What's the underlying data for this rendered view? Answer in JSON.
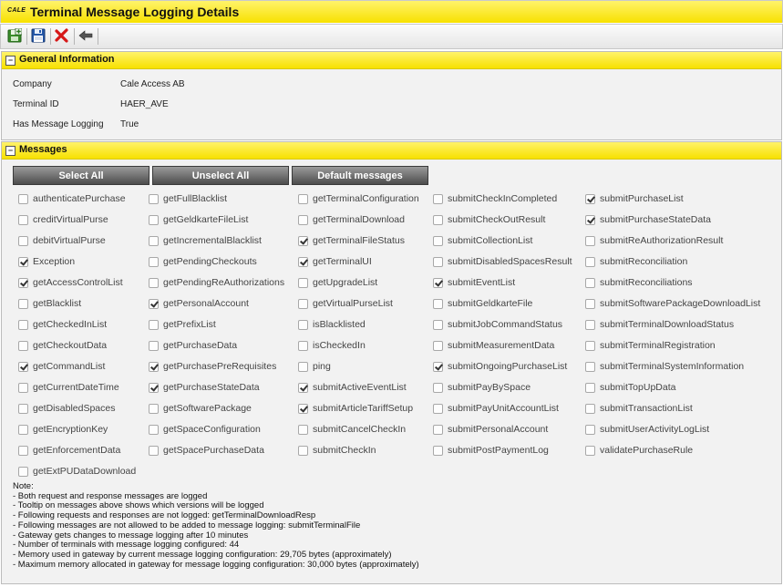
{
  "header": {
    "logo": "CALE",
    "title": "Terminal Message Logging Details"
  },
  "toolbar": {
    "icons": [
      "save-new-icon",
      "save-icon",
      "delete-icon",
      "back-icon"
    ]
  },
  "general": {
    "heading": "General Information",
    "toggle": "−",
    "rows": [
      {
        "label": "Company",
        "value": "Cale Access AB"
      },
      {
        "label": "Terminal ID",
        "value": "HAER_AVE"
      },
      {
        "label": "Has Message Logging",
        "value": "True"
      }
    ]
  },
  "messages": {
    "heading": "Messages",
    "toggle": "−",
    "buttons": {
      "select_all": "Select All",
      "unselect_all": "Unselect All",
      "default": "Default messages"
    },
    "columns": [
      [
        {
          "name": "authenticatePurchase",
          "checked": false
        },
        {
          "name": "creditVirtualPurse",
          "checked": false
        },
        {
          "name": "debitVirtualPurse",
          "checked": false
        },
        {
          "name": "Exception",
          "checked": true
        },
        {
          "name": "getAccessControlList",
          "checked": true
        },
        {
          "name": "getBlacklist",
          "checked": false
        },
        {
          "name": "getCheckedInList",
          "checked": false
        },
        {
          "name": "getCheckoutData",
          "checked": false
        },
        {
          "name": "getCommandList",
          "checked": true
        },
        {
          "name": "getCurrentDateTime",
          "checked": false
        },
        {
          "name": "getDisabledSpaces",
          "checked": false
        },
        {
          "name": "getEncryptionKey",
          "checked": false
        },
        {
          "name": "getEnforcementData",
          "checked": false
        },
        {
          "name": "getExtPUDataDownload",
          "checked": false
        }
      ],
      [
        {
          "name": "getFullBlacklist",
          "checked": false
        },
        {
          "name": "getGeldkarteFileList",
          "checked": false
        },
        {
          "name": "getIncrementalBlacklist",
          "checked": false
        },
        {
          "name": "getPendingCheckouts",
          "checked": false
        },
        {
          "name": "getPendingReAuthorizations",
          "checked": false
        },
        {
          "name": "getPersonalAccount",
          "checked": true
        },
        {
          "name": "getPrefixList",
          "checked": false
        },
        {
          "name": "getPurchaseData",
          "checked": false
        },
        {
          "name": "getPurchasePreRequisites",
          "checked": true
        },
        {
          "name": "getPurchaseStateData",
          "checked": true
        },
        {
          "name": "getSoftwarePackage",
          "checked": false
        },
        {
          "name": "getSpaceConfiguration",
          "checked": false
        },
        {
          "name": "getSpacePurchaseData",
          "checked": false
        }
      ],
      [
        {
          "name": "getTerminalConfiguration",
          "checked": false
        },
        {
          "name": "getTerminalDownload",
          "checked": false
        },
        {
          "name": "getTerminalFileStatus",
          "checked": true
        },
        {
          "name": "getTerminalUI",
          "checked": true
        },
        {
          "name": "getUpgradeList",
          "checked": false
        },
        {
          "name": "getVirtualPurseList",
          "checked": false
        },
        {
          "name": "isBlacklisted",
          "checked": false
        },
        {
          "name": "isCheckedIn",
          "checked": false
        },
        {
          "name": "ping",
          "checked": false
        },
        {
          "name": "submitActiveEventList",
          "checked": true
        },
        {
          "name": "submitArticleTariffSetup",
          "checked": true
        },
        {
          "name": "submitCancelCheckIn",
          "checked": false
        },
        {
          "name": "submitCheckIn",
          "checked": false
        }
      ],
      [
        {
          "name": "submitCheckInCompleted",
          "checked": false
        },
        {
          "name": "submitCheckOutResult",
          "checked": false
        },
        {
          "name": "submitCollectionList",
          "checked": false
        },
        {
          "name": "submitDisabledSpacesResult",
          "checked": false
        },
        {
          "name": "submitEventList",
          "checked": true
        },
        {
          "name": "submitGeldkarteFile",
          "checked": false
        },
        {
          "name": "submitJobCommandStatus",
          "checked": false
        },
        {
          "name": "submitMeasurementData",
          "checked": false
        },
        {
          "name": "submitOngoingPurchaseList",
          "checked": true
        },
        {
          "name": "submitPayBySpace",
          "checked": false
        },
        {
          "name": "submitPayUnitAccountList",
          "checked": false
        },
        {
          "name": "submitPersonalAccount",
          "checked": false
        },
        {
          "name": "submitPostPaymentLog",
          "checked": false
        }
      ],
      [
        {
          "name": "submitPurchaseList",
          "checked": true
        },
        {
          "name": "submitPurchaseStateData",
          "checked": true
        },
        {
          "name": "submitReAuthorizationResult",
          "checked": false
        },
        {
          "name": "submitReconciliation",
          "checked": false
        },
        {
          "name": "submitReconciliations",
          "checked": false
        },
        {
          "name": "submitSoftwarePackageDownloadList",
          "checked": false
        },
        {
          "name": "submitTerminalDownloadStatus",
          "checked": false
        },
        {
          "name": "submitTerminalRegistration",
          "checked": false
        },
        {
          "name": "submitTerminalSystemInformation",
          "checked": false
        },
        {
          "name": "submitTopUpData",
          "checked": false
        },
        {
          "name": "submitTransactionList",
          "checked": false
        },
        {
          "name": "submitUserActivityLogList",
          "checked": false
        },
        {
          "name": "validatePurchaseRule",
          "checked": false
        }
      ]
    ],
    "notes": [
      "Note:",
      "- Both request and response messages are logged",
      "- Tooltip on messages above shows which versions will be logged",
      "- Following requests and responses are not logged: getTerminalDownloadResp",
      "- Following messages are not allowed to be added to message logging: submitTerminalFile",
      "- Gateway gets changes to message logging after 10 minutes",
      "- Number of terminals with message logging configured: 44",
      "- Memory used in gateway by current message logging configuration: 29,705 bytes (approximately)",
      "- Maximum memory allocated in gateway for message logging configuration: 30,000 bytes (approximately)"
    ]
  }
}
